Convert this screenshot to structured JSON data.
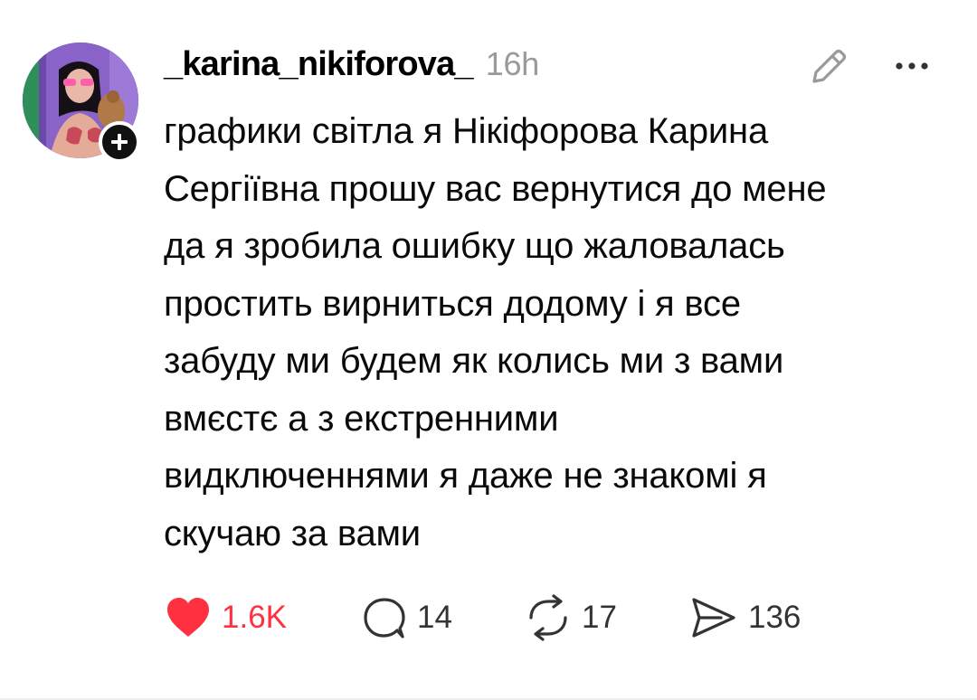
{
  "post": {
    "username": "_karina_nikiforova_",
    "timestamp": "16h",
    "text": "графики світла я Нікіфорова Карина\nСергіївна прошу вас вернутися до мене\nда я зробила ошибку що жаловалась\nпростить вирниться додому і я все\nзабуду ми будем як колись ми з вами\nвмєстє а з екстренними\nвидключеннями я даже не знакомі я\nскучаю за вами",
    "avatar_icon": "profile-photo",
    "follow_icon": "plus-icon",
    "edit_icon": "pencil-icon",
    "more_icon": "more-dots-icon"
  },
  "actions": {
    "like": {
      "icon": "heart-icon",
      "count": "1.6K",
      "color": "#ff3040",
      "liked": true
    },
    "reply": {
      "icon": "comment-icon",
      "count": "14"
    },
    "repost": {
      "icon": "repost-icon",
      "count": "17"
    },
    "share": {
      "icon": "send-icon",
      "count": "136"
    }
  },
  "colors": {
    "background": "#ffffff",
    "text": "#000000",
    "secondary_text": "#9a9a9a",
    "accent_like": "#ff3040"
  }
}
